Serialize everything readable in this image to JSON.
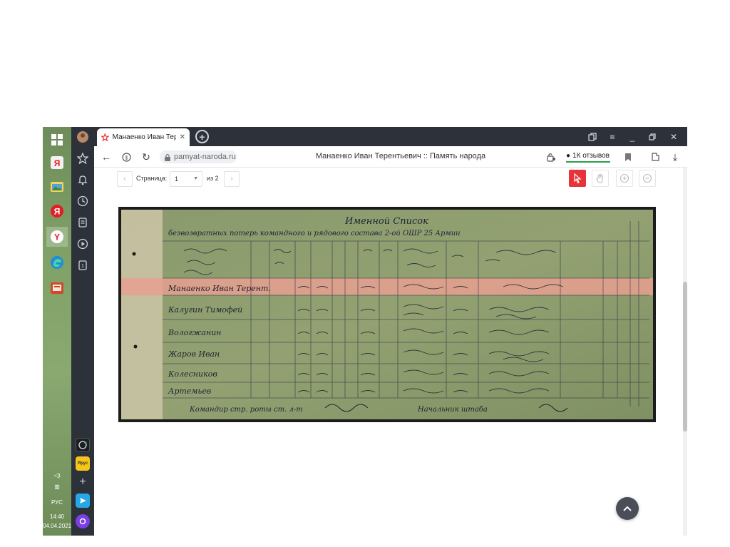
{
  "taskbar": {
    "language": "РУС",
    "time": "14:40",
    "date": "04.04.2021"
  },
  "browser": {
    "tab_title": "Манаенко Иван Терен",
    "url": "pamyat-naroda.ru",
    "page_title": "Манаенко Иван Терентьевич :: Память народа",
    "reviews_label": "1К отзывов",
    "sidebar_apps": {
      "bookmark_badge": "Ярус"
    }
  },
  "viewer": {
    "page_label": "Страница:",
    "page_current": "1",
    "page_total": "из 2"
  },
  "document": {
    "header_line1": "Именной Список",
    "header_line2": "безвозвратных потерь командного и рядового состава 2-ой ОШР 25 Армии",
    "rows": [
      "Манаенко Иван Терент.",
      "Калугин Тимофей",
      "Вологжанин",
      "Жаров Иван",
      "Колесников",
      "Артемьев"
    ],
    "footer": "Командир стр. роты  ст. л-т",
    "footer_sign": "Начальник штаба"
  },
  "colors": {
    "accent_red": "#e8333a",
    "highlight_row": "#e8a090",
    "browser_dark": "#2c313a",
    "reviews_underline": "#2aa14a"
  }
}
